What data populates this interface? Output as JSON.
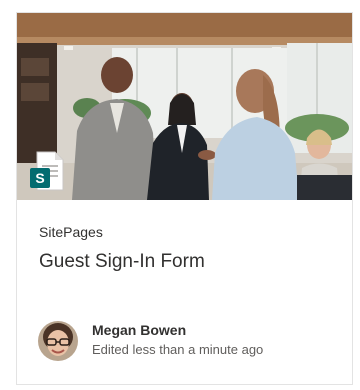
{
  "card": {
    "site_name": "SitePages",
    "title": "Guest Sign-In Form",
    "author": "Megan Bowen",
    "edited": "Edited less than a minute ago",
    "file_icon": "sharepoint-page-icon",
    "file_icon_letter": "S",
    "thumbnail": "office-lobby-photo",
    "avatar": "avatar-photo"
  },
  "colors": {
    "sharepoint_teal": "#036c70",
    "text_primary": "#323130",
    "text_secondary": "#605e5c"
  }
}
